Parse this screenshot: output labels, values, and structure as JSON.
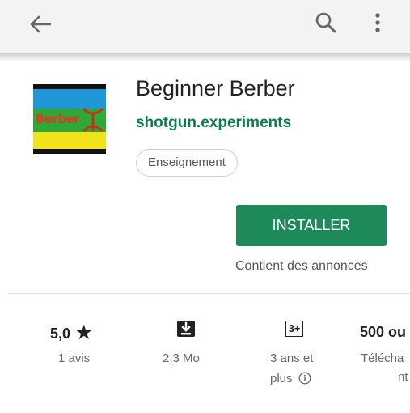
{
  "toolbar": {
    "back_icon": "arrow-back-icon",
    "search_icon": "search-icon",
    "more_icon": "more-vert-icon"
  },
  "app": {
    "icon_text": "Berber",
    "title": "Beginner Berber",
    "developer": "shotgun.experiments",
    "category": "Enseignement"
  },
  "actions": {
    "install_label": "INSTALLER",
    "ads_notice": "Contient des annonces"
  },
  "stats": {
    "rating_value": "5,0",
    "rating_star": "★",
    "rating_count": "1 avis",
    "size": "2,3 Mo",
    "content_rating_badge": "3+",
    "content_rating_line1": "3 ans et",
    "content_rating_line2": "plus",
    "downloads_value": "500 ou",
    "downloads_line1": "Télécha",
    "downloads_line2": "nt"
  },
  "colors": {
    "accent_green": "#1f8a59",
    "developer_green": "#0a7d4e"
  }
}
